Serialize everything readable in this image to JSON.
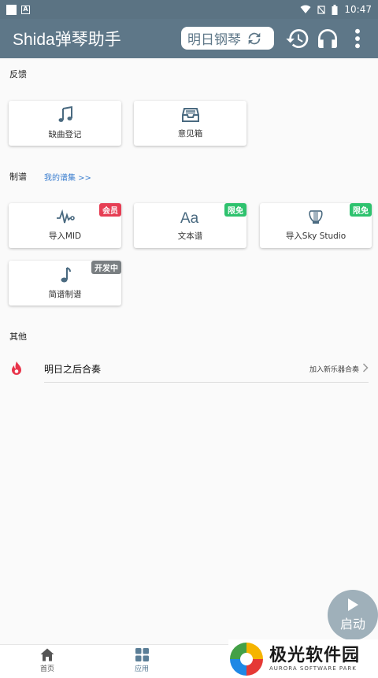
{
  "status_bar": {
    "time": "10:47"
  },
  "app_bar": {
    "title": "Shida弹琴助手",
    "instrument": "明日钢琴"
  },
  "sections": {
    "feedback": {
      "label": "反馈",
      "cards": [
        {
          "label": "缺曲登记",
          "icon": "music-note-icon"
        },
        {
          "label": "意见箱",
          "icon": "inbox-icon"
        }
      ]
    },
    "score_making": {
      "label": "制谱",
      "link": "我的谱集 >>",
      "cards": [
        {
          "label": "导入MID",
          "icon": "waveform-icon",
          "badge": "会员",
          "badge_color": "#e63e54"
        },
        {
          "label": "文本谱",
          "icon": "text-aa-icon",
          "badge": "限免",
          "badge_color": "#2ec26e"
        },
        {
          "label": "导入Sky Studio",
          "icon": "lyre-icon",
          "badge": "限免",
          "badge_color": "#2ec26e"
        },
        {
          "label": "简谱制谱",
          "icon": "single-note-icon",
          "badge": "开发中",
          "badge_color": "#7a7f82"
        }
      ]
    },
    "other": {
      "label": "其他",
      "rows": [
        {
          "title": "明日之后合奏",
          "hint": "加入新乐器合奏",
          "icon": "flame-icon"
        }
      ]
    }
  },
  "fab": {
    "label": "启动"
  },
  "bottom_nav": {
    "items": [
      {
        "label": "首页",
        "icon": "home-icon"
      },
      {
        "label": "应用",
        "icon": "apps-grid-icon",
        "active": true
      }
    ]
  },
  "watermark": {
    "main": "极光软件园",
    "sub": "AURORA SOFTWARE PARK"
  },
  "colors": {
    "primary": "#5e7788",
    "accent": "#4a6a80",
    "link": "#3b7ecf"
  }
}
